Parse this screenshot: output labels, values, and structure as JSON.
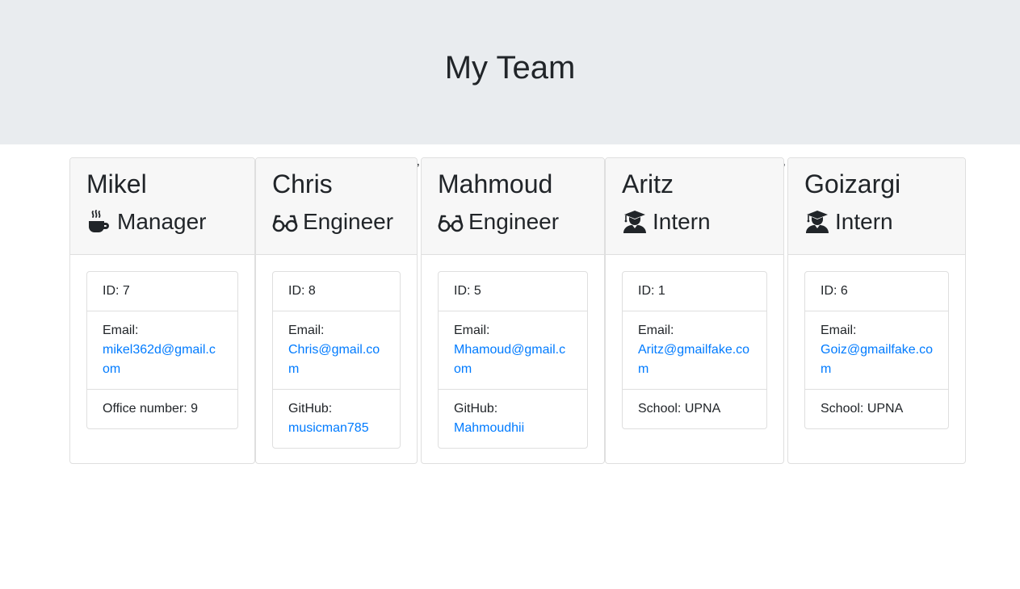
{
  "page": {
    "title": "My Team"
  },
  "separators": [
    "’",
    "’"
  ],
  "labels": {
    "id": "ID:",
    "email": "Email:",
    "github": "GitHub:",
    "office": "Office number:",
    "school": "School:"
  },
  "team": [
    {
      "name": "Mikel",
      "role": "Manager",
      "icon": "coffee-icon",
      "id": "ID: 7",
      "email_label": "Email:",
      "email": "mikel362d@gmail.com",
      "extra_label": "Office number: 9",
      "extra_link": ""
    },
    {
      "name": "Chris",
      "role": "Engineer",
      "icon": "glasses-icon",
      "id": "ID: 8",
      "email_label": "Email:",
      "email": "Chris@gmail.com",
      "extra_label": "GitHub:",
      "extra_link": "musicman785"
    },
    {
      "name": "Mahmoud",
      "role": "Engineer",
      "icon": "glasses-icon",
      "id": "ID: 5",
      "email_label": "Email:",
      "email": "Mhamoud@gmail.com",
      "extra_label": "GitHub:",
      "extra_link": "Mahmoudhii"
    },
    {
      "name": "Aritz",
      "role": "Intern",
      "icon": "user-graduate-icon",
      "id": "ID: 1",
      "email_label": "Email:",
      "email": "Aritz@gmailfake.com",
      "extra_label": "School: UPNA",
      "extra_link": ""
    },
    {
      "name": "Goizargi",
      "role": "Intern",
      "icon": "user-graduate-icon",
      "id": "ID: 6",
      "email_label": "Email:",
      "email": "Goiz@gmailfake.com",
      "extra_label": "School: UPNA",
      "extra_link": ""
    }
  ]
}
